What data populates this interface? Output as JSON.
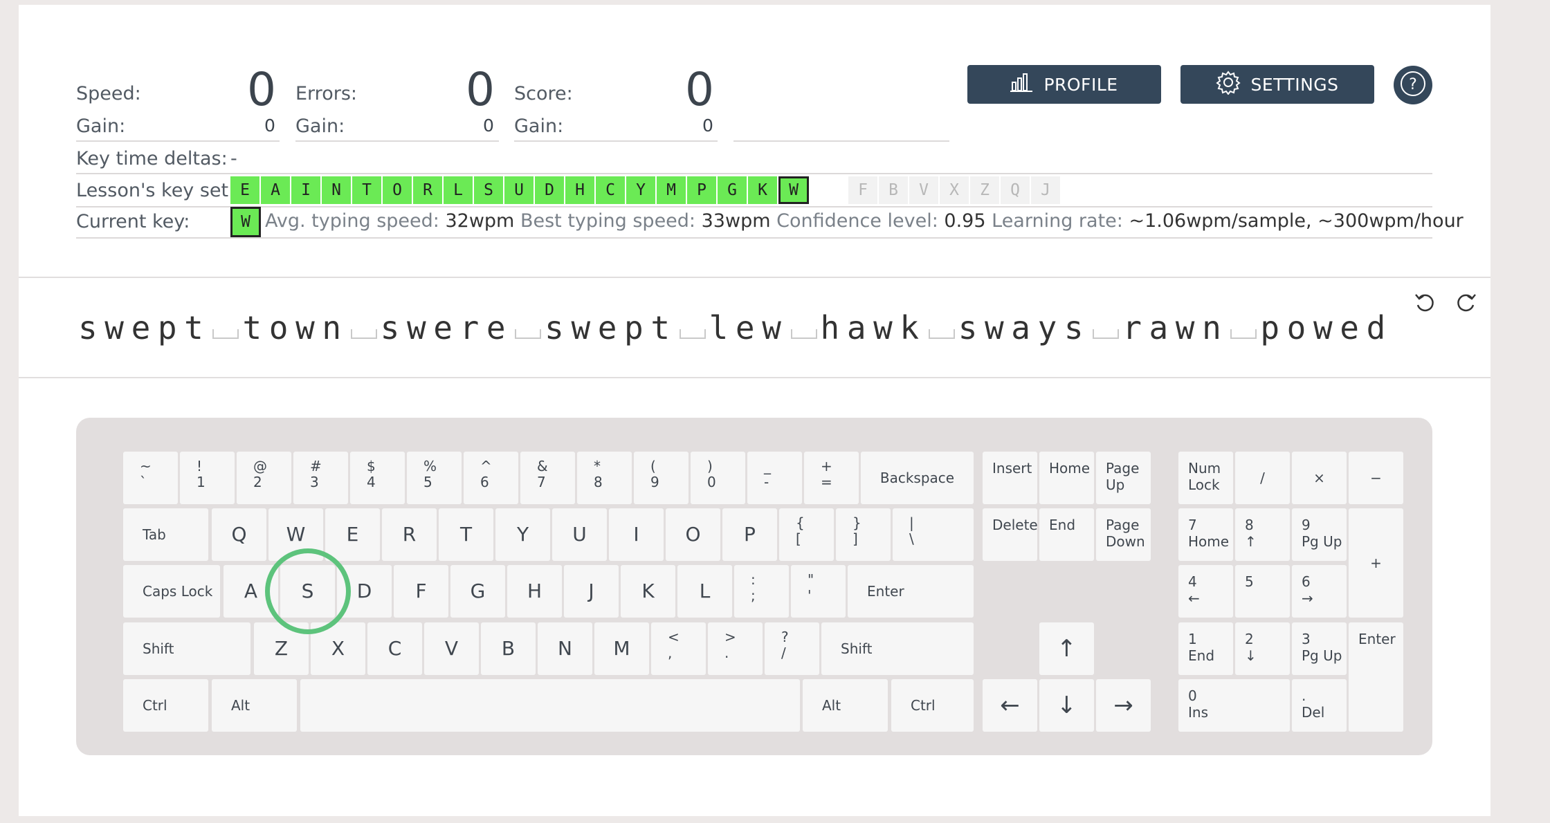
{
  "stats": {
    "speed": {
      "label": "Speed:",
      "value": "0",
      "gain_label": "Gain:",
      "gain": "0"
    },
    "errors": {
      "label": "Errors:",
      "value": "0",
      "gain_label": "Gain:",
      "gain": "0"
    },
    "score": {
      "label": "Score:",
      "value": "0",
      "gain_label": "Gain:",
      "gain": "0"
    }
  },
  "buttons": {
    "profile": "PROFILE",
    "settings": "SETTINGS",
    "help_icon": "question-icon",
    "profile_icon": "bar-chart-icon",
    "settings_icon": "gear-icon"
  },
  "key_time_deltas": {
    "label": "Key time deltas:",
    "value": "-"
  },
  "lesson_key_set": {
    "label": "Lesson's key set:",
    "included": [
      "E",
      "A",
      "I",
      "N",
      "T",
      "O",
      "R",
      "L",
      "S",
      "U",
      "D",
      "H",
      "C",
      "Y",
      "M",
      "P",
      "G",
      "K",
      "W"
    ],
    "current": "W",
    "excluded": [
      "F",
      "B",
      "V",
      "X",
      "Z",
      "Q",
      "J"
    ]
  },
  "current_key": {
    "label": "Current key:",
    "key": "W",
    "avg_label": "Avg. typing speed:",
    "avg_value": "32wpm",
    "best_label": "Best typing speed:",
    "best_value": "33wpm",
    "conf_label": "Confidence level:",
    "conf_value": "0.95",
    "rate_label": "Learning rate:",
    "rate_value": "~1.06wpm/sample, ~300wpm/hour"
  },
  "lesson_words": [
    "swept",
    "town",
    "swere",
    "swept",
    "lew",
    "hawk",
    "sways",
    "rawn",
    "powed"
  ],
  "lesson_controls": {
    "reset_icon": "undo-icon",
    "skip_icon": "redo-icon"
  },
  "keyboard": {
    "highlighted_key": "S",
    "highlight_color": "#5dc37c",
    "included_key_color": "#6bea55",
    "keys": [
      "~\n`",
      "!\n1",
      "@\n2",
      "#\n3",
      "$\n4",
      "%\n5",
      "^\n6",
      "&\n7",
      "*\n8",
      "(\n9",
      ")\n0",
      "_\n-",
      "+\n=",
      "Backspace",
      "Tab",
      "Q",
      "W",
      "E",
      "R",
      "T",
      "Y",
      "U",
      "I",
      "O",
      "P",
      "{\n[",
      "}\n]",
      "|\n\\",
      "Caps Lock",
      "A",
      "S",
      "D",
      "F",
      "G",
      "H",
      "J",
      "K",
      "L",
      ":\n;",
      "\"\n'",
      "Enter",
      "Shift",
      "Z",
      "X",
      "C",
      "V",
      "B",
      "N",
      "M",
      "<\n,",
      ">\n.",
      "?\n/",
      "Shift",
      "Ctrl",
      "Alt",
      "",
      "Alt",
      "Ctrl",
      "Insert",
      "Home",
      "Page\nUp",
      "Delete",
      "End",
      "Page\nDown",
      "↑",
      "←",
      "↓",
      "→",
      "Num\nLock",
      "/",
      "×",
      "−",
      "7\nHome",
      "8\n↑",
      "9\nPg Up",
      "+",
      "4\n←",
      "5",
      "6\n→",
      "1\nEnd",
      "2\n↓",
      "3\nPg Up",
      "Enter",
      "0\nIns",
      ".\nDel"
    ]
  }
}
